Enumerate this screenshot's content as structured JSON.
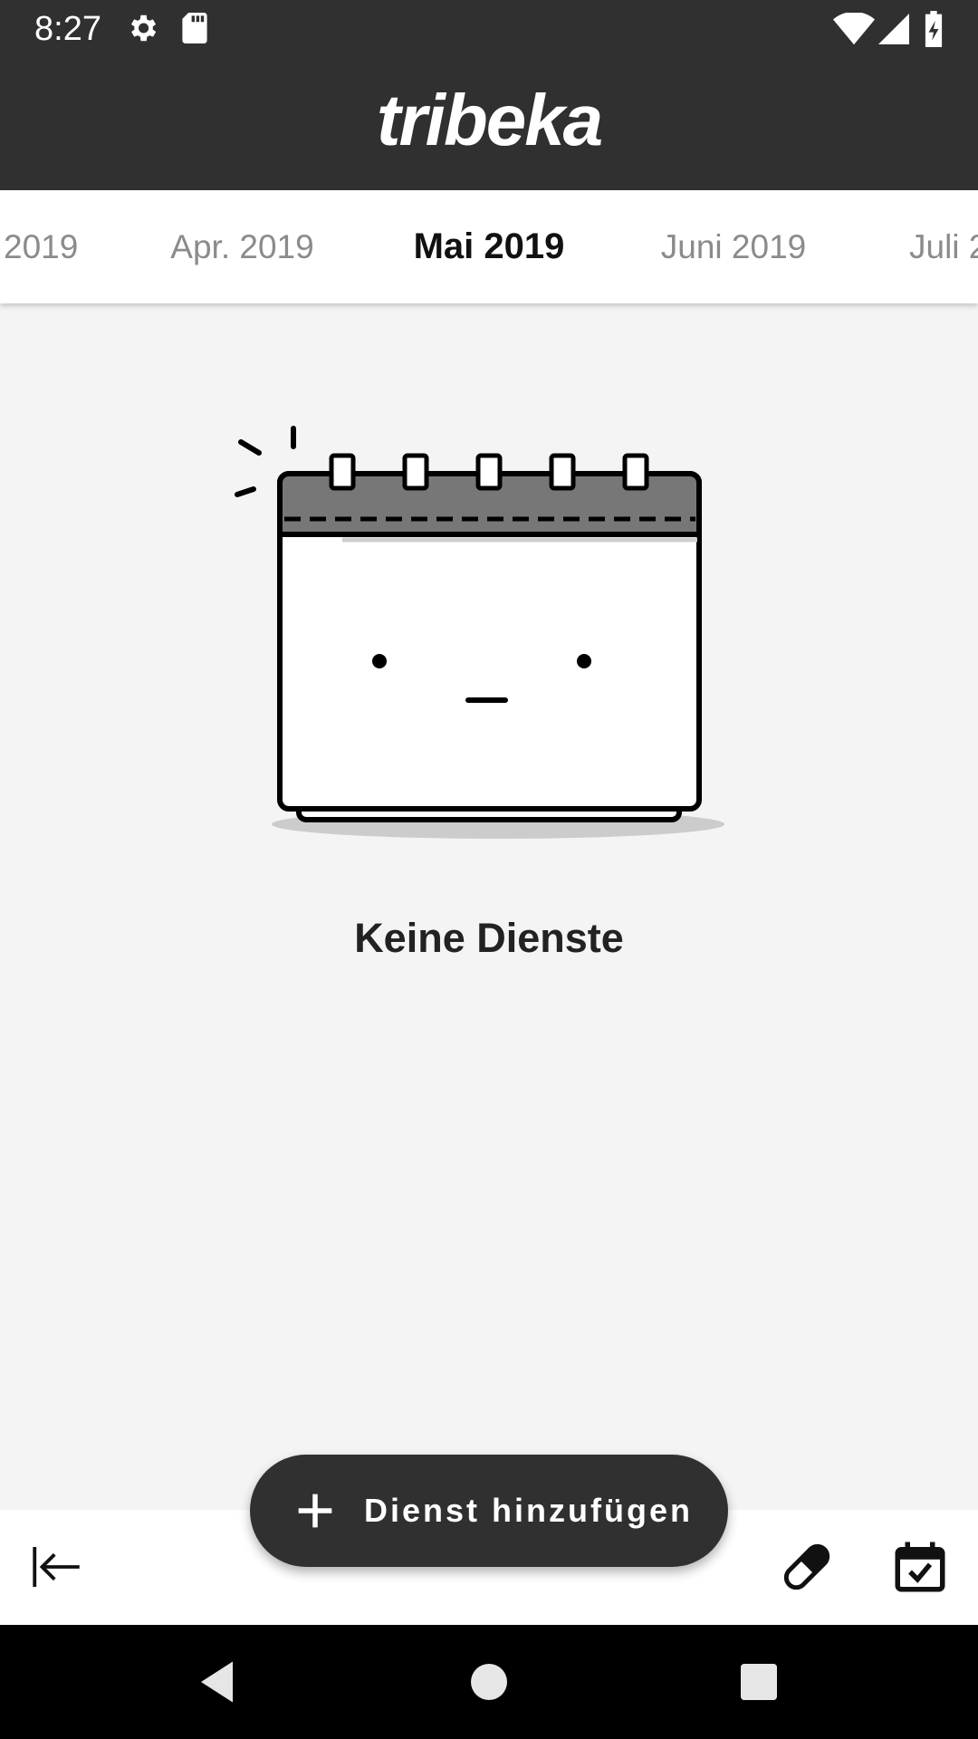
{
  "status_bar": {
    "time": "8:27",
    "icons": [
      "gear-icon",
      "sd-card-icon",
      "wifi-icon",
      "cell-signal-icon",
      "battery-charging-icon"
    ]
  },
  "app_bar": {
    "logo": "tribeka"
  },
  "month_tabs": [
    {
      "label": "2019",
      "active": false
    },
    {
      "label": "Apr. 2019",
      "active": false
    },
    {
      "label": "Mai 2019",
      "active": true
    },
    {
      "label": "Juni 2019",
      "active": false
    },
    {
      "label": "Juli 2",
      "active": false
    }
  ],
  "empty_state": {
    "illustration": "calendar-face-icon",
    "title": "Keine Dienste"
  },
  "fab": {
    "icon": "plus-icon",
    "label": "Dienst hinzufügen"
  },
  "bottom_bar": {
    "left_icon": "collapse-left-icon",
    "right_icons": [
      "pill-icon",
      "calendar-check-icon"
    ]
  },
  "nav_bar": {
    "buttons": [
      "back-triangle-icon",
      "home-circle-icon",
      "recents-square-icon"
    ]
  },
  "colors": {
    "dark": "#303030",
    "background": "#f4f4f4",
    "inactive_tab": "#8b8b8b"
  }
}
